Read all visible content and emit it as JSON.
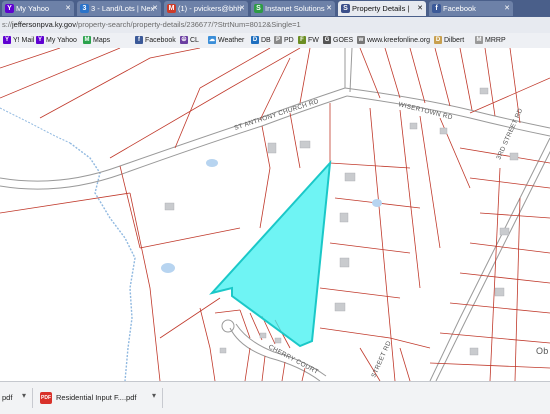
{
  "tabs": [
    {
      "label": "My Yahoo",
      "icon": "yahoo-icon",
      "color": "#5f01d1",
      "glyph": "Y"
    },
    {
      "label": "3 - Land/Lots | Nex",
      "icon": "listing-icon",
      "color": "#2b73c9",
      "glyph": "3"
    },
    {
      "label": "(1) - pvickers@bhh",
      "icon": "mail-icon",
      "color": "#cc3b2a",
      "glyph": "M"
    },
    {
      "label": "Instanet Solutions",
      "icon": "instanet-icon",
      "color": "#2e9b45",
      "glyph": "S"
    },
    {
      "label": "Property Details |",
      "icon": "property-icon",
      "color": "#3b4f8a",
      "glyph": "S"
    },
    {
      "label": "Facebook",
      "icon": "facebook-icon",
      "color": "#3b5998",
      "glyph": "f"
    }
  ],
  "address": {
    "prefix": "s://",
    "domain": "jeffersonpva.ky.gov",
    "path": "/property-search/property-details/236677/?StrtNum=8012&Single=1"
  },
  "bookmarks": [
    {
      "label": "Y! Mail",
      "icon": "yahoo-mail-icon",
      "color": "#5f01d1",
      "glyph": "Y"
    },
    {
      "label": "My Yahoo",
      "icon": "yahoo-icon",
      "color": "#5f01d1",
      "glyph": "Y"
    },
    {
      "label": "Maps",
      "icon": "maps-icon",
      "color": "#2ba24c",
      "glyph": "M"
    },
    {
      "label": "Facebook",
      "icon": "facebook-icon",
      "color": "#3b5998",
      "glyph": "f"
    },
    {
      "label": "CL",
      "icon": "peace-icon",
      "color": "#6a3ea1",
      "glyph": "☮"
    },
    {
      "label": "Weather",
      "icon": "weather-icon",
      "color": "#3b8ed8",
      "glyph": "☁"
    },
    {
      "label": "DB",
      "icon": "db-icon",
      "color": "#1f6fbf",
      "glyph": "D"
    },
    {
      "label": "PD",
      "icon": "pd-icon",
      "color": "#8a8a8a",
      "glyph": "P"
    },
    {
      "label": "FW",
      "icon": "fw-icon",
      "color": "#6b8e23",
      "glyph": "F"
    },
    {
      "label": "GOES",
      "icon": "goes-icon",
      "color": "#555555",
      "glyph": "G"
    },
    {
      "label": "www.kreefonline.org",
      "icon": "web-icon",
      "color": "#777777",
      "glyph": "w"
    },
    {
      "label": "Dilbert",
      "icon": "dilbert-icon",
      "color": "#c8a050",
      "glyph": "D"
    },
    {
      "label": "MRRP",
      "icon": "mrrp-icon",
      "color": "#999999",
      "glyph": "M"
    }
  ],
  "map": {
    "road_labels": {
      "st_anthony": "ST ANTHONY CHURCH RD",
      "wisertown": "WISERTOWN RD",
      "third_street": "3RD STREET RD",
      "cherry": "CHERRY COURT",
      "street_rd": "STREET RD",
      "corner": "Ob"
    },
    "parcel_line_color": "#c0392b",
    "highlight_color": "#3ff0f0"
  },
  "downloads": [
    {
      "label": "pdf",
      "icon": "pdf-icon"
    },
    {
      "label": "Residential Input F....pdf",
      "icon": "pdf-icon"
    }
  ]
}
